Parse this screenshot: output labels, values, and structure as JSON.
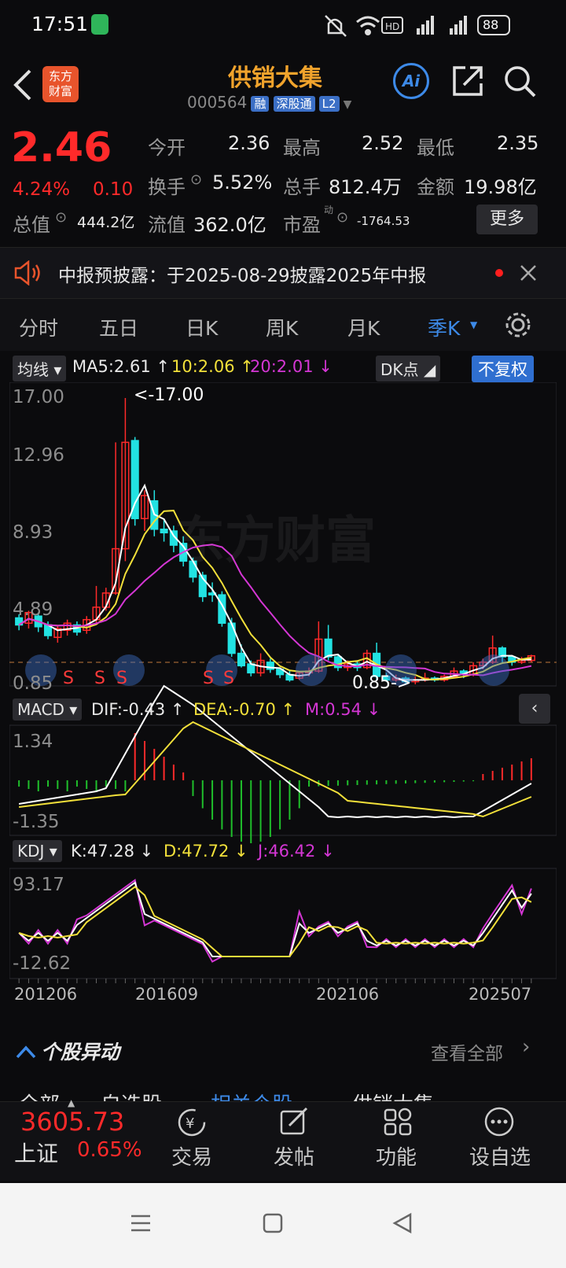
{
  "status_bar": {
    "time": "17:51",
    "network": "HD",
    "battery": "88"
  },
  "header": {
    "logo_text": "东方\n财富",
    "title": "供销大集",
    "code": "000564",
    "badges": [
      "融",
      "深股通",
      "L2"
    ],
    "ai_label": "Ai"
  },
  "quote": {
    "price": "2.46",
    "pct": "4.24%",
    "change": "0.10",
    "stats": [
      {
        "label": "今开",
        "value": "2.36"
      },
      {
        "label": "最高",
        "value": "2.52"
      },
      {
        "label": "最低",
        "value": "2.35"
      },
      {
        "label": "换手",
        "value": "5.52%"
      },
      {
        "label": "总手",
        "value": "812.4万"
      },
      {
        "label": "金额",
        "value": "19.98亿"
      },
      {
        "label": "总值",
        "value": "444.2亿"
      },
      {
        "label": "流值",
        "value": "362.0亿"
      },
      {
        "label": "市盈",
        "value": "-1764.53"
      }
    ],
    "pe_superscript": "动",
    "more_label": "更多"
  },
  "notice": {
    "text": "中报预披露：于2025-08-29披露2025年中报"
  },
  "tabs": [
    "分时",
    "五日",
    "日K",
    "周K",
    "月K",
    "季K",
    "⚙"
  ],
  "active_tab": "季K",
  "indicators": {
    "ma": {
      "label": "均线",
      "ma5": "MA5:2.61 ↑",
      "ma10": "10:2.06 ↑",
      "ma20": "20:2.01 ↓"
    },
    "dk_label": "DK点",
    "adjust_label": "不复权",
    "macd": {
      "label": "MACD",
      "dif": "DIF:-0.43 ↑",
      "dea": "DEA:-0.70 ↑",
      "m": "M:0.54 ↓"
    },
    "kdj": {
      "label": "KDJ",
      "k": "K:47.28 ↓",
      "d": "D:47.72 ↓",
      "j": "J:46.42 ↓"
    }
  },
  "chart_data": {
    "type": "candlestick",
    "main_axis": [
      "17.00",
      "12.96",
      "8.93",
      "4.89",
      "0.85"
    ],
    "max_annotation": "<-17.00",
    "min_annotation": "0.85->",
    "watermark": "东方财富",
    "macd_axis": [
      "1.34",
      "-1.35"
    ],
    "kdj_axis": [
      "93.17",
      "-12.62"
    ],
    "x_labels": [
      "201206",
      "201609",
      "202106",
      "202507"
    ],
    "s_markers": [
      "S",
      "S",
      "S",
      "S",
      "S"
    ]
  },
  "section": {
    "title": "个股异动",
    "link": "查看全部"
  },
  "partial_tabs": [
    "全部",
    "自选股",
    "相关个股",
    "供销大集"
  ],
  "bottom_nav": {
    "index_value": "3605.73",
    "index_name": "上证",
    "index_pct": "0.65%",
    "items": [
      "交易",
      "发帖",
      "功能",
      "设自选"
    ]
  }
}
